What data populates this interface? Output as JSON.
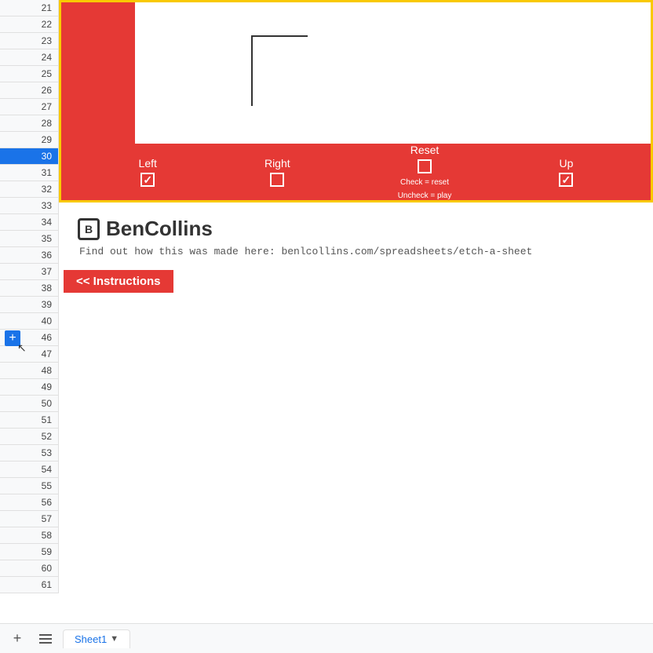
{
  "rows": {
    "numbers": [
      21,
      22,
      23,
      24,
      25,
      26,
      27,
      28,
      29,
      30,
      31,
      32,
      33,
      34,
      35,
      36,
      37,
      38,
      39,
      40,
      46,
      47,
      48,
      49,
      50,
      51,
      52,
      53,
      54,
      55,
      56,
      57,
      58,
      59,
      60,
      61
    ],
    "selected_row": 30
  },
  "controls": {
    "left": {
      "label": "Left",
      "checked": true
    },
    "right": {
      "label": "Right",
      "checked": false
    },
    "reset": {
      "label": "Reset",
      "checked": false,
      "info1": "Check = reset",
      "info2": "Uncheck = play"
    },
    "up": {
      "label": "Up",
      "checked": true
    }
  },
  "brand": {
    "icon": "B",
    "name": "BenCollins",
    "tagline": "Find out how this was made here: benlcollins.com/spreadsheets/etch-a-sheet"
  },
  "instructions": {
    "label": "<< Instructions"
  },
  "sheet_tab": {
    "name": "Sheet1"
  },
  "bottom_bar": {
    "add_label": "+",
    "menu_label": "☰"
  },
  "add_row_button": "+",
  "colors": {
    "red": "#e53935",
    "yellow": "#f9c900",
    "blue": "#1a73e8"
  }
}
